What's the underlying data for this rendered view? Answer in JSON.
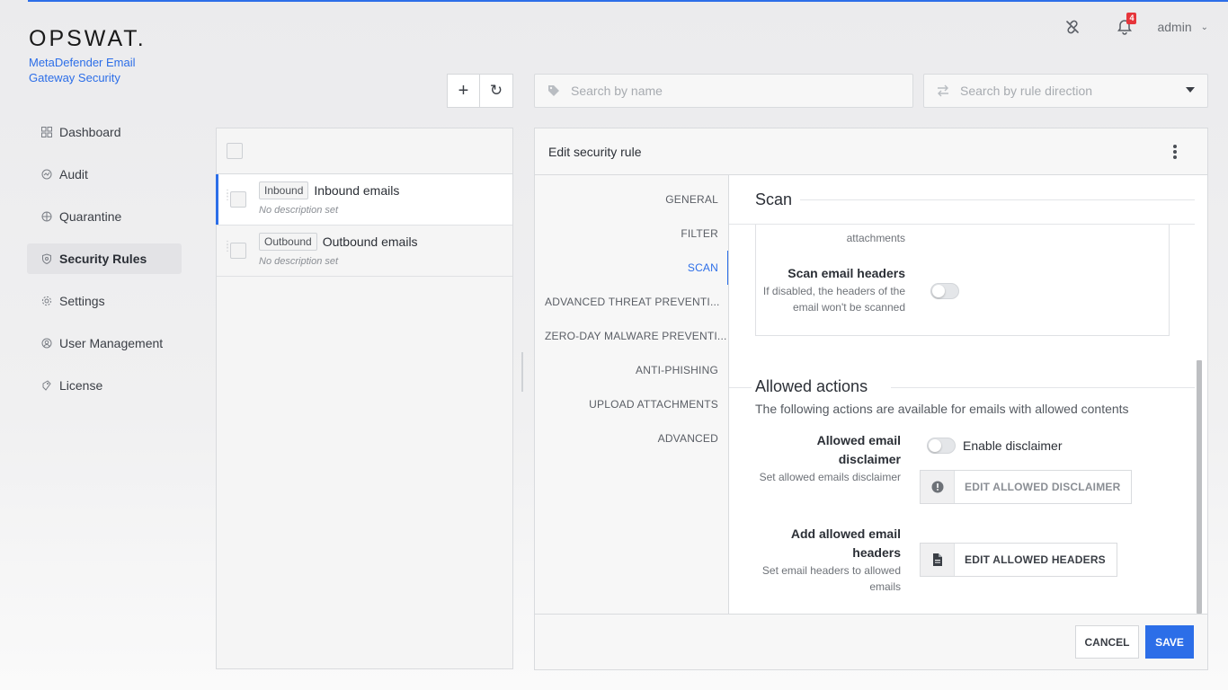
{
  "brand": {
    "logo": "OPSWAT.",
    "product": "MetaDefender Email Gateway Security"
  },
  "header": {
    "notifications_count": "4",
    "user": "admin"
  },
  "sidebar": {
    "items": [
      {
        "label": "Dashboard",
        "icon": "dashboard-icon"
      },
      {
        "label": "Audit",
        "icon": "audit-icon"
      },
      {
        "label": "Quarantine",
        "icon": "quarantine-icon"
      },
      {
        "label": "Security Rules",
        "icon": "shield-icon",
        "active": true
      },
      {
        "label": "Settings",
        "icon": "gear-icon"
      },
      {
        "label": "User Management",
        "icon": "user-icon"
      },
      {
        "label": "License",
        "icon": "license-icon"
      }
    ]
  },
  "toolbar": {
    "add": "+",
    "refresh": "↻"
  },
  "search": {
    "name_placeholder": "Search by name",
    "direction_placeholder": "Search by rule direction"
  },
  "rules": [
    {
      "tag": "Inbound",
      "name": "Inbound emails",
      "description": "No description set",
      "selected": true
    },
    {
      "tag": "Outbound",
      "name": "Outbound emails",
      "description": "No description set",
      "selected": false
    }
  ],
  "editor": {
    "title": "Edit security rule",
    "tabs": [
      "GENERAL",
      "FILTER",
      "SCAN",
      "ADVANCED THREAT PREVENTI...",
      "ZERO-DAY MALWARE PREVENTI...",
      "ANTI-PHISHING",
      "UPLOAD ATTACHMENTS",
      "ADVANCED"
    ],
    "active_tab": "SCAN",
    "scan": {
      "title": "Scan",
      "partial_text": "attachments",
      "headers_label": "Scan email headers",
      "headers_desc": "If disabled, the headers of the email won't be scanned"
    },
    "allowed": {
      "title": "Allowed actions",
      "description": "The following actions are available for emails with allowed contents",
      "disclaimer_label": "Allowed email disclaimer",
      "disclaimer_desc": "Set allowed emails disclaimer",
      "enable_disclaimer": "Enable disclaimer",
      "edit_disclaimer": "EDIT ALLOWED DISCLAIMER",
      "headers_label": "Add allowed email headers",
      "headers_desc": "Set email headers to allowed emails",
      "edit_headers": "EDIT ALLOWED HEADERS"
    },
    "cancel": "CANCEL",
    "save": "SAVE"
  }
}
